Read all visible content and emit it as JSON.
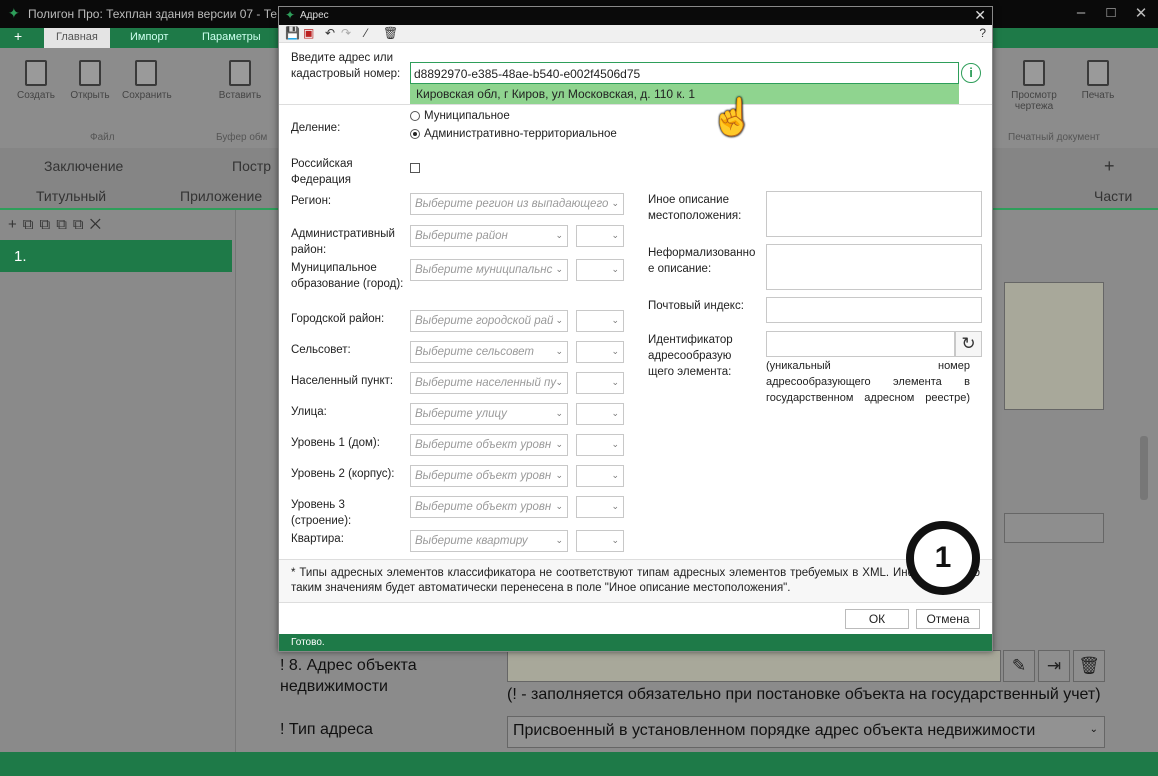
{
  "app": {
    "title": "Полигон Про: Техплан здания версии 07 - Те",
    "tabs": [
      "Главная",
      "Импорт",
      "Параметры"
    ],
    "ribbon_buttons": [
      "Создать",
      "Открыть",
      "Сохранить",
      "Вставить",
      "Просмотр чертежа",
      "Печать"
    ],
    "ribbon_groups": [
      "Файл",
      "Буфер обм",
      "Печатный документ"
    ],
    "sections_row1": [
      "Заключение",
      "Постр"
    ],
    "sections_row2": [
      "Титульный",
      "Приложение",
      "Части"
    ],
    "left_item": "1.",
    "label_address": "! 8. Адрес объекта недвижимости",
    "label_address_note": "(! - заполняется обязательно при постановке объекта на государственный учет)",
    "label_type": "! Тип адреса",
    "type_value": "Присвоенный в установленном порядке адрес объекта недвижимости"
  },
  "dialog": {
    "title": "Адрес",
    "help": "?",
    "address_label": "Введите адрес или кадастровый номер:",
    "address_value": "d8892970-e385-48ae-b540-e002f4506d75",
    "suggestion": "Кировская обл, г Киров, ул Московская, д. 110 к. 1",
    "division_label": "Деление:",
    "division_options": [
      "Муниципальное",
      "Административно-территориальное"
    ],
    "division_selected": 1,
    "rf_label": "Российская Федерация",
    "fields": {
      "region": {
        "label": "Регион:",
        "placeholder": "Выберите регион из выпадающего"
      },
      "admin_district": {
        "label": "Административный район:",
        "placeholder": "Выберите район"
      },
      "municipal": {
        "label": "Муниципальное образование (город):",
        "placeholder": "Выберите муниципальнс"
      },
      "city_district": {
        "label": "Городской район:",
        "placeholder": "Выберите городской рай"
      },
      "selsovet": {
        "label": "Сельсовет:",
        "placeholder": "Выберите сельсовет"
      },
      "locality": {
        "label": "Населенный пункт:",
        "placeholder": "Выберите населенный пу"
      },
      "street": {
        "label": "Улица:",
        "placeholder": "Выберите улицу"
      },
      "level1": {
        "label": "Уровень 1 (дом):",
        "placeholder": "Выберите объект уровн"
      },
      "level2": {
        "label": "Уровень 2 (корпус):",
        "placeholder": "Выберите объект уровн"
      },
      "level3": {
        "label": "Уровень 3 (строение):",
        "placeholder": "Выберите объект уровн"
      },
      "apartment": {
        "label": "Квартира:",
        "placeholder": "Выберите квартиру"
      }
    },
    "other_location_label": "Иное описание местоположения:",
    "informal_label": "Неформализованное описание:",
    "postal_label": "Почтовый индекс:",
    "id_label": "Идентификатор адресообразующего элемента:",
    "id_note": "(уникальный номер адресообразующего элемента в государственном адресном реестре)",
    "note": "* Типы адресных элементов классификатора не соответствуют типам адресных элементов требуемых в XML. Информация по таким значениям будет автоматически перенесена в поле \"Иное описание местоположения\".",
    "ok": "ОК",
    "cancel": "Отмена",
    "status": "Готово."
  },
  "badge": "1"
}
